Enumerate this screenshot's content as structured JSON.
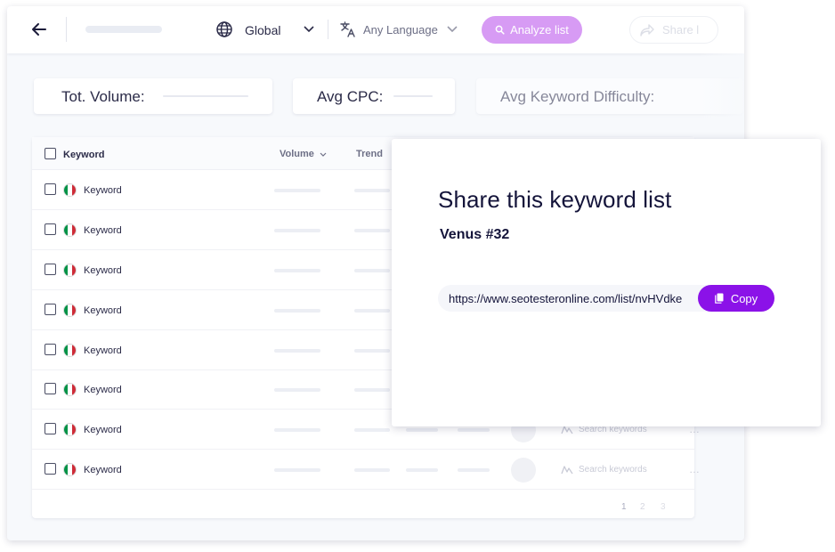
{
  "toolbar": {
    "location_label": "Global",
    "language_label": "Any Language",
    "analyze_label": "Analyze list",
    "share_label": "Share l"
  },
  "stats": {
    "total_volume_label": "Tot. Volume:",
    "avg_cpc_label": "Avg CPC:",
    "avg_kd_label": "Avg Keyword Difficulty:"
  },
  "table": {
    "headers": {
      "keyword": "Keyword",
      "volume": "Volume",
      "trend": "Trend"
    },
    "rows": [
      {
        "keyword": "Keyword"
      },
      {
        "keyword": "Keyword"
      },
      {
        "keyword": "Keyword"
      },
      {
        "keyword": "Keyword"
      },
      {
        "keyword": "Keyword"
      },
      {
        "keyword": "Keyword"
      },
      {
        "keyword": "Keyword",
        "action": "Search keywords"
      },
      {
        "keyword": "Keyword",
        "action": "Search keywords"
      }
    ],
    "pagination": [
      "1",
      "2",
      "3"
    ]
  },
  "modal": {
    "title": "Share this keyword list",
    "list_name": "Venus #32",
    "url": "https://www.seotesteronline.com/list/nvHVdke",
    "copy_label": "Copy"
  },
  "colors": {
    "accent": "#8b12e8",
    "accent_light": "#d79bf4",
    "flag_green": "#009246",
    "flag_red": "#ce2b37"
  }
}
